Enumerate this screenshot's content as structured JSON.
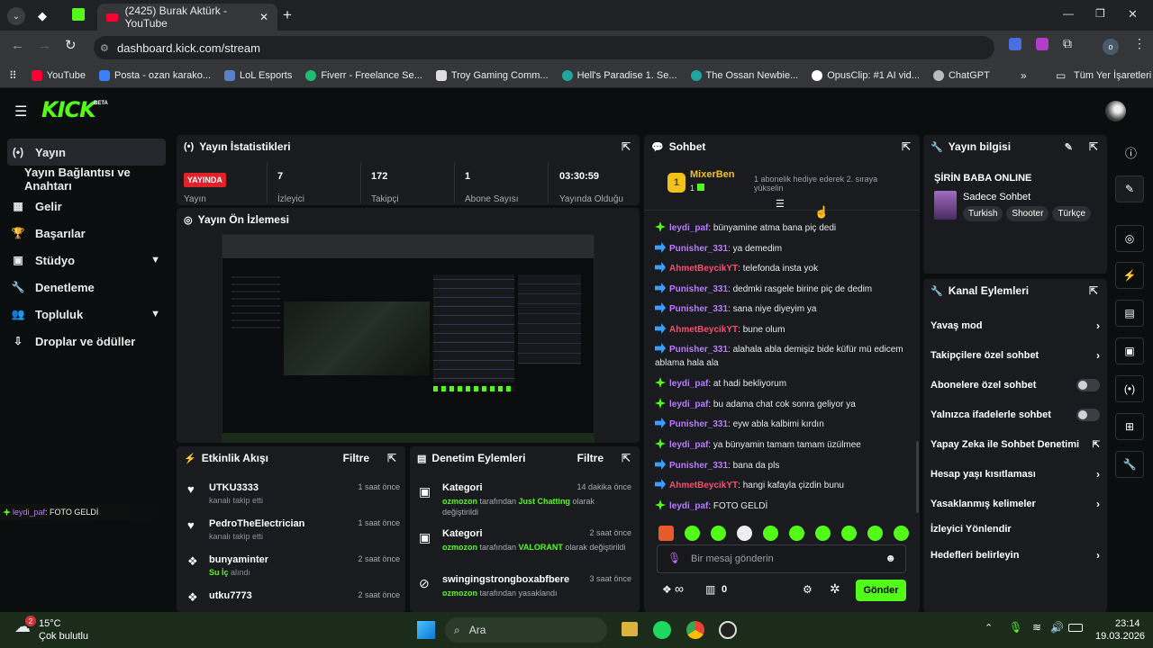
{
  "browser": {
    "tab_title": "(2425) Burak Aktürk - YouTube",
    "url": "dashboard.kick.com/stream",
    "bookmarks": [
      "YouTube",
      "Posta - ozan karako...",
      "LoL Esports",
      "Fiverr - Freelance Se...",
      "Troy Gaming Comm...",
      "Hell's Paradise 1. Se...",
      "The Ossan Newbie...",
      "OpusClip: #1 AI vid...",
      "ChatGPT"
    ],
    "all_bookmarks": "Tüm Yer İşaretleri",
    "profile_initial": "o"
  },
  "kick": {
    "logo": "KICK",
    "beta": "BETA"
  },
  "sidebar": {
    "items": [
      {
        "icon": "(•)",
        "label": "Yayın"
      },
      {
        "icon": "",
        "label": "Yayın Bağlantısı ve Anahtarı"
      },
      {
        "icon": "▦",
        "label": "Gelir"
      },
      {
        "icon": "🏆",
        "label": "Başarılar"
      },
      {
        "icon": "▣",
        "label": "Stüdyo"
      },
      {
        "icon": "🔧",
        "label": "Denetleme"
      },
      {
        "icon": "👥",
        "label": "Topluluk"
      },
      {
        "icon": "⇩",
        "label": "Droplar ve ödüller"
      }
    ],
    "overlay_user": "leydi_paf",
    "overlay_msg": ": FOTO GELDİ"
  },
  "stats": {
    "title": "Yayın İstatistikleri",
    "live": "YAYINDA",
    "live_label": "Yayın",
    "values": [
      {
        "value": "7",
        "label": "İzleyici"
      },
      {
        "value": "172",
        "label": "Takipçi"
      },
      {
        "value": "1",
        "label": "Abone Sayısı"
      },
      {
        "value": "03:30:59",
        "label": "Yayında Olduğu"
      }
    ]
  },
  "preview": {
    "title": "Yayın Ön İzlemesi"
  },
  "activity": {
    "title": "Etkinlik Akışı",
    "filter": "Filtre",
    "events": [
      {
        "name": "UTKU3333",
        "sub": "kanalı takip etti",
        "time": "1 saat önce"
      },
      {
        "name": "PedroTheElectrician",
        "sub": "kanalı takip etti",
        "time": "1 saat önce"
      },
      {
        "name": "bunyaminter",
        "sub_hl": "Su İç",
        "sub": " alındı",
        "time": "2 saat önce"
      },
      {
        "name": "utku7773",
        "sub": "",
        "time": "2 saat önce"
      }
    ]
  },
  "moderation": {
    "title": "Denetim Eylemleri",
    "filter": "Filtre",
    "items": [
      {
        "title": "Kategori",
        "user": "ozmozon",
        "mid": " tarafından ",
        "hl": "Just Chatting",
        "rest": " olarak değiştirildi",
        "time": "14 dakika önce"
      },
      {
        "title": "Kategori",
        "user": "ozmozon",
        "mid": " tarafından ",
        "hl": "VALORANT",
        "rest": " olarak değiştirildi",
        "time": "2 saat önce"
      },
      {
        "title": "swingingstrongboxabfbere",
        "user": "ozmozon",
        "mid": " tarafından yasaklandı",
        "hl": "",
        "rest": "",
        "time": "3 saat önce"
      }
    ]
  },
  "chat": {
    "title": "Sohbet",
    "pinned_user": "MixerBen",
    "pinned_count": "1",
    "pinned_badge": "1",
    "pinned_text": "1 abonelik hediye ederek 2. sıraya yükselin",
    "messages": [
      {
        "badge": "gift",
        "user": "leydi_paf",
        "color": "#b77cff",
        "text": ": bünyamine atma bana piç dedi"
      },
      {
        "badge": "sub",
        "user": "Punisher_331",
        "color": "#b77cff",
        "text": ": ya demedim"
      },
      {
        "badge": "sub",
        "user": "AhmetBeycikYT",
        "color": "#ff4b6e",
        "text": ": telefonda insta yok"
      },
      {
        "badge": "sub",
        "user": "Punisher_331",
        "color": "#b77cff",
        "text": ": dedmki rasgele birine piç de dedim"
      },
      {
        "badge": "sub",
        "user": "Punisher_331",
        "color": "#b77cff",
        "text": ": sana niye diyeyim ya"
      },
      {
        "badge": "sub",
        "user": "AhmetBeycikYT",
        "color": "#ff4b6e",
        "text": ": bune olum"
      },
      {
        "badge": "sub",
        "user": "Punisher_331",
        "color": "#b77cff",
        "text": ": alahala abla demişiz bide küfür mü edicem ablama hala ala"
      },
      {
        "badge": "gift",
        "user": "leydi_paf",
        "color": "#b77cff",
        "text": ": at hadi bekliyorum"
      },
      {
        "badge": "gift",
        "user": "leydi_paf",
        "color": "#b77cff",
        "text": ": bu adama chat cok sonra geliyor ya"
      },
      {
        "badge": "sub",
        "user": "Punisher_331",
        "color": "#b77cff",
        "text": ": eyw abla kalbimi kırdın"
      },
      {
        "badge": "gift",
        "user": "leydi_paf",
        "color": "#b77cff",
        "text": ": ya bünyamin tamam tamam üzülmee"
      },
      {
        "badge": "sub",
        "user": "Punisher_331",
        "color": "#b77cff",
        "text": ": bana da pls"
      },
      {
        "badge": "sub",
        "user": "AhmetBeycikYT",
        "color": "#ff4b6e",
        "text": ": hangi kafayla çizdin bunu"
      },
      {
        "badge": "gift",
        "user": "leydi_paf",
        "color": "#b77cff",
        "text": ": FOTO GELDİ"
      }
    ],
    "input_placeholder": "Bir mesaj gönderin",
    "points": "∞",
    "gifts": "0",
    "send": "Gönder"
  },
  "stream_info": {
    "title": "Yayın bilgisi",
    "stream_name": "ŞİRİN BABA ONLINE",
    "category": "Sadece Sohbet",
    "tags": [
      "Turkish",
      "Shooter",
      "Türkçe"
    ]
  },
  "channel_actions": {
    "title": "Kanal Eylemleri",
    "items": [
      {
        "label": "Yavaş mod",
        "kind": "arrow"
      },
      {
        "label": "Takipçilere özel sohbet",
        "kind": "arrow"
      },
      {
        "label": "Abonelere özel sohbet",
        "kind": "toggle"
      },
      {
        "label": "Yalnızca ifadelerle sohbet",
        "kind": "toggle"
      },
      {
        "label": "Yapay Zeka ile Sohbet Denetimi",
        "kind": "external"
      },
      {
        "label": "Hesap yaşı kısıtlaması",
        "kind": "arrow"
      },
      {
        "label": "Yasaklanmış kelimeler",
        "kind": "arrow"
      },
      {
        "label": "İzleyici Yönlendir",
        "kind": "none"
      },
      {
        "label": "Hedefleri belirleyin",
        "kind": "arrow"
      }
    ]
  },
  "taskbar": {
    "weather_temp": "15°C",
    "weather_desc": "Çok bulutlu",
    "weather_badge": "2",
    "search": "Ara",
    "time": "23:14",
    "date": "19.03.2026"
  },
  "colors": {
    "brand": "#53fc18",
    "live": "#e0222a",
    "panel": "#191b1f",
    "bg": "#0b0e0f"
  }
}
